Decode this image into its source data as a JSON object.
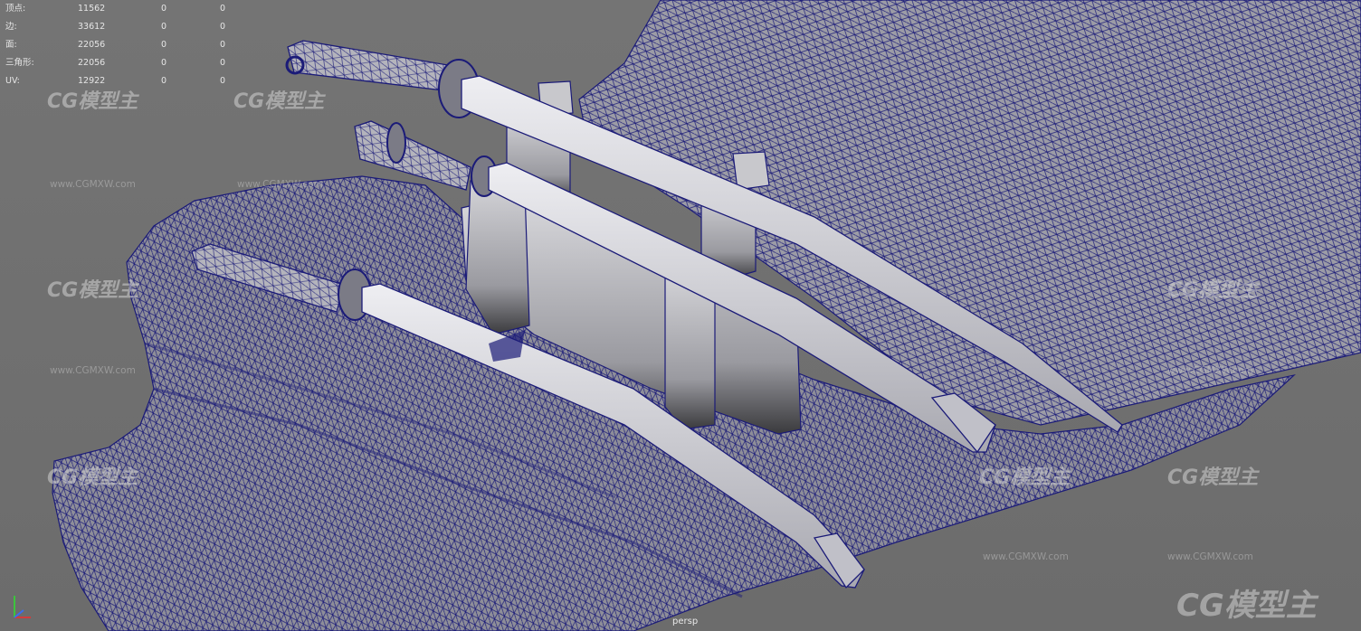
{
  "stats": {
    "rows": [
      {
        "label": "顶点:",
        "v1": "11562",
        "v2": "0",
        "v3": "0"
      },
      {
        "label": "边:",
        "v1": "33612",
        "v2": "0",
        "v3": "0"
      },
      {
        "label": "面:",
        "v1": "22056",
        "v2": "0",
        "v3": "0"
      },
      {
        "label": "三角形:",
        "v1": "22056",
        "v2": "0",
        "v3": "0"
      },
      {
        "label": "UV:",
        "v1": "12922",
        "v2": "0",
        "v3": "0"
      }
    ]
  },
  "viewport": {
    "camera_label": "persp"
  },
  "watermark": {
    "logo_text": "CG模型主",
    "url_text": "www.CGMXW.com"
  },
  "colors": {
    "background": "#707070",
    "wireframe": "#1a1a7a",
    "mesh_fill": "#9a9aa3"
  }
}
